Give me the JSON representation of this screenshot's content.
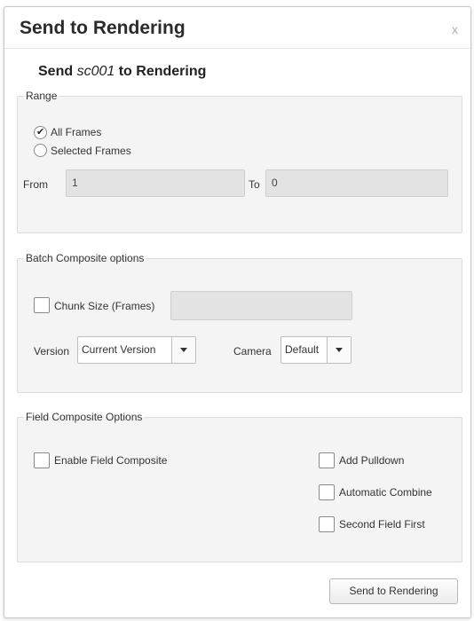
{
  "dialog": {
    "title": "Send to Rendering",
    "close_label": "x",
    "heading_prefix": "Send ",
    "heading_scene": "sc001",
    "heading_suffix": " to Rendering"
  },
  "range": {
    "legend": "Range",
    "all_frames_label": "All Frames",
    "selected_frames_label": "Selected Frames",
    "selected_option": "All Frames",
    "from_label": "From",
    "from_value": "1",
    "to_label": "To",
    "to_value": "0"
  },
  "batch": {
    "legend": "Batch Composite options",
    "chunk_label": "Chunk Size (Frames)",
    "chunk_checked": false,
    "chunk_value": "",
    "version_label": "Version",
    "version_value": "Current Version",
    "camera_label": "Camera",
    "camera_value": "Default"
  },
  "field": {
    "legend": "Field Composite Options",
    "enable_label": "Enable Field Composite",
    "add_pulldown_label": "Add Pulldown",
    "auto_combine_label": "Automatic Combine",
    "second_field_label": "Second Field First"
  },
  "footer": {
    "send_button_label": "Send to Rendering"
  }
}
